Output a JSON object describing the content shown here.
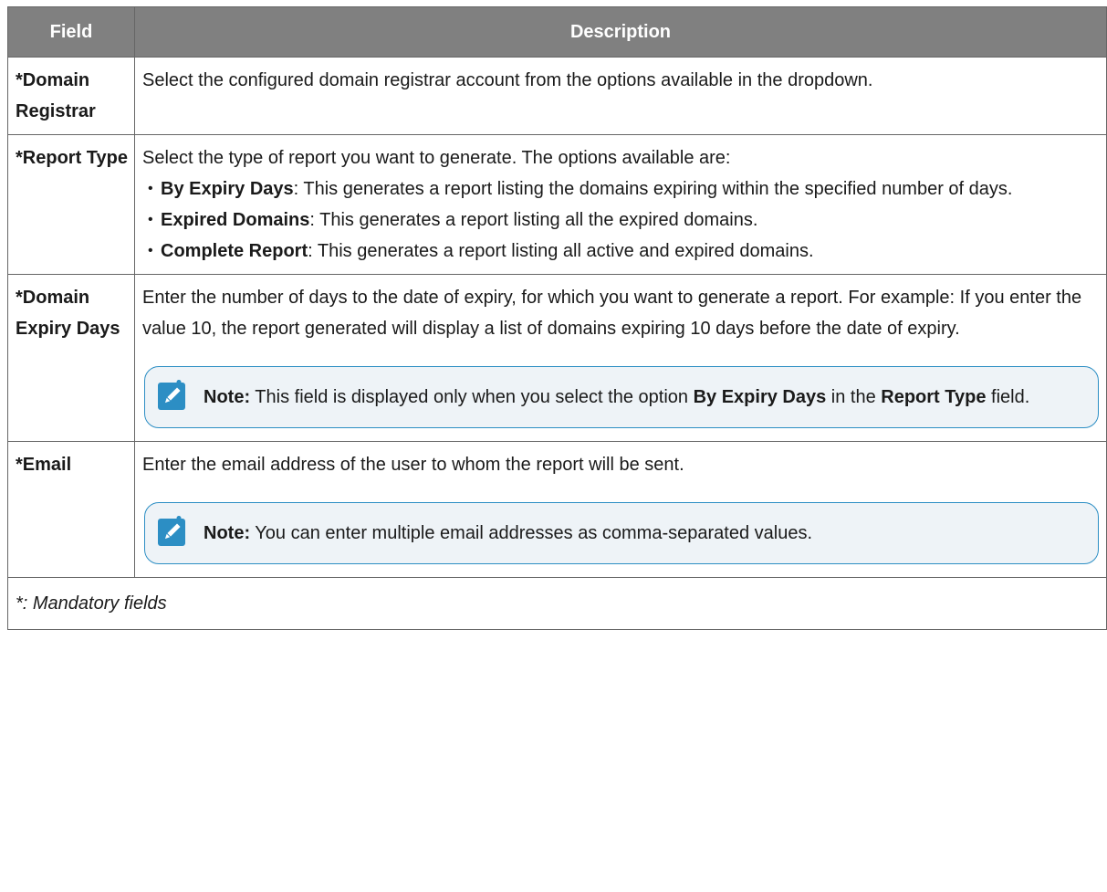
{
  "header": {
    "field": "Field",
    "description": "Description"
  },
  "rows": {
    "registrar": {
      "field": "*Domain Registrar",
      "description": "Select the configured domain registrar account from the options available in the dropdown."
    },
    "report_type": {
      "field": "*Report Type",
      "intro": "Select the type of report you want to generate. The options available are:",
      "options": [
        {
          "name": "By Expiry Days",
          "text": ": This generates a report listing the domains expiring within the specified number of days."
        },
        {
          "name": "Expired Domains",
          "text": ": This generates a report listing all the expired domains."
        },
        {
          "name": "Complete Report",
          "text": ": This generates a report listing all active and expired domains."
        }
      ]
    },
    "expiry_days": {
      "field": "*Domain Expiry Days",
      "description": "Enter the number of days to the date of expiry, for which you want to generate a report. For example: If you enter the value 10, the report generated will display a list of domains expiring 10 days before the date of expiry.",
      "note": {
        "label": "Note:",
        "text_1": " This field is displayed only when you select the option ",
        "bold_1": "By Expiry Days",
        "text_2": " in the ",
        "bold_2": "Report Type",
        "text_3": " field."
      }
    },
    "email": {
      "field": "*Email",
      "description": "Enter the email address of the user to whom the report will be sent.",
      "note": {
        "label": "Note:",
        "text": " You can enter multiple email addresses as comma-separated values."
      }
    }
  },
  "footer": "*: Mandatory fields",
  "colors": {
    "header_bg": "#808080",
    "note_border": "#2c8ec4",
    "note_bg": "#eef3f7",
    "icon_bg": "#2c8ec4"
  },
  "icons": {
    "note": "pencil-note-icon"
  }
}
